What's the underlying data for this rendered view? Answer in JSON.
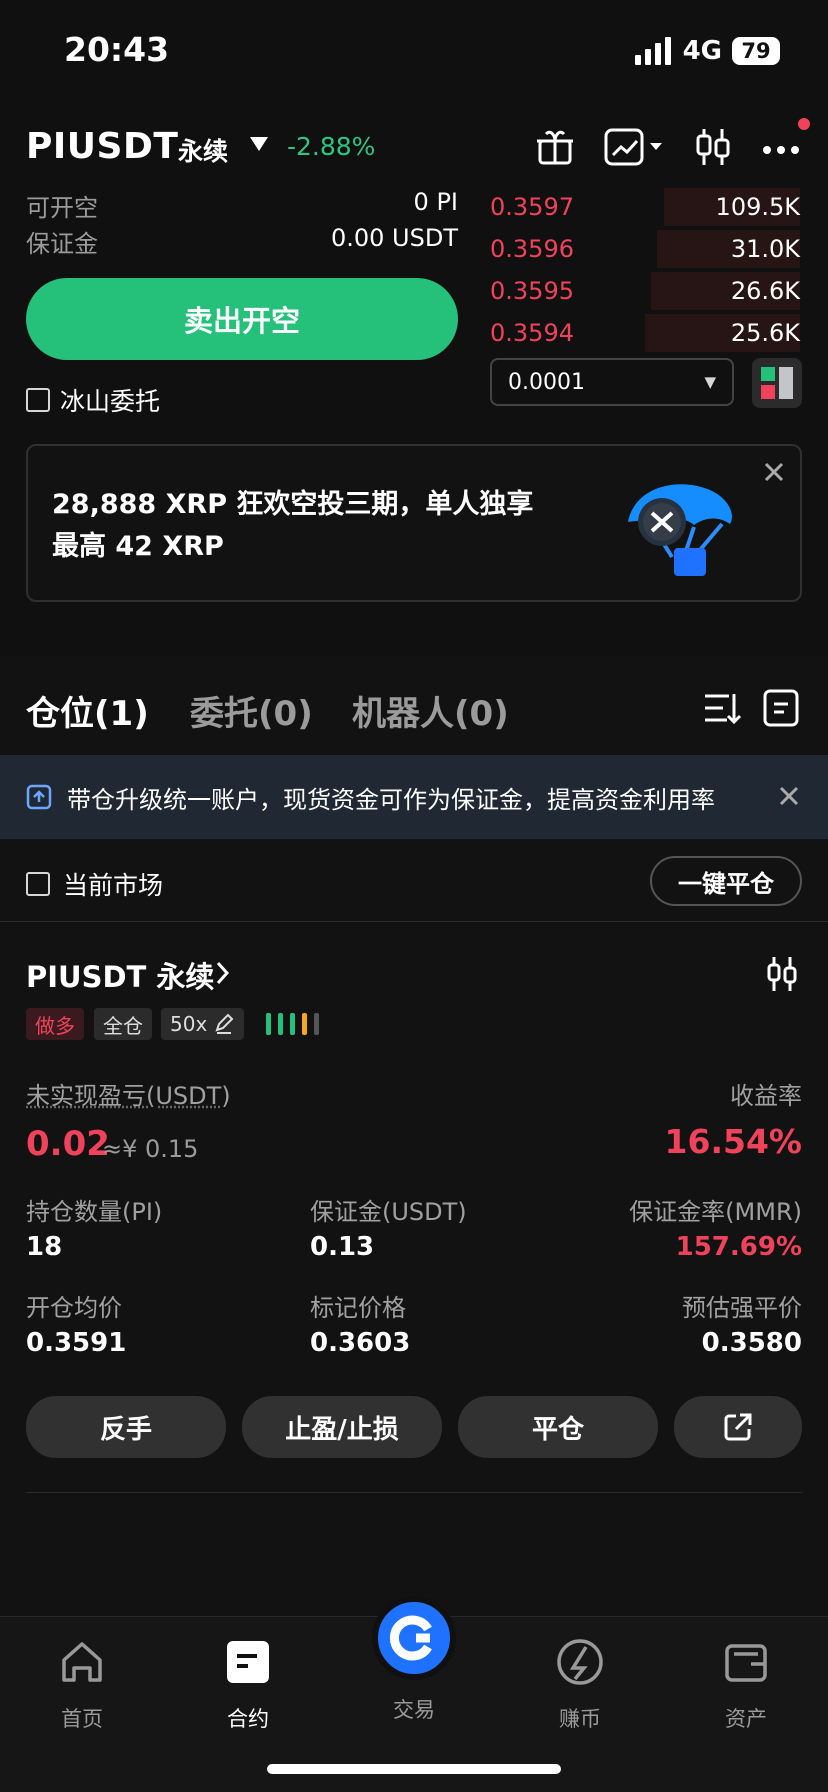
{
  "status": {
    "time": "20:43",
    "network": "4G",
    "battery": "79"
  },
  "header": {
    "symbol": "PIUSDT",
    "contract_type": "永续",
    "change": "-2.88%"
  },
  "trade": {
    "open_short_label": "可开空",
    "open_short_value": "0 PI",
    "margin_label": "保证金",
    "margin_value": "0.00 USDT",
    "sell_button": "卖出开空",
    "iceberg_label": "冰山委托",
    "order_book": [
      {
        "price": "0.3597",
        "size": "109.5K",
        "depth": 0.44
      },
      {
        "price": "0.3596",
        "size": "31.0K",
        "depth": 0.46
      },
      {
        "price": "0.3595",
        "size": "26.6K",
        "depth": 0.48
      },
      {
        "price": "0.3594",
        "size": "25.6K",
        "depth": 0.5
      }
    ],
    "precision": "0.0001"
  },
  "promo": {
    "line1": "28,888 XRP 狂欢空投三期，单人独享",
    "line2": "最高 42 XRP"
  },
  "tabs": [
    "仓位(1)",
    "委托(0)",
    "机器人(0)"
  ],
  "notice": {
    "text": "带仓升级统一账户，现货资金可作为保证金，提高资金利用率"
  },
  "filter": {
    "current_market": "当前市场",
    "close_all": "一键平仓"
  },
  "position": {
    "symbol": "PIUSDT 永续",
    "side": "做多",
    "margin_mode": "全仓",
    "leverage": "50x",
    "unrealized_label": "未实现盈亏(USDT)",
    "unrealized_value": "0.02",
    "unrealized_cny": "≈¥ 0.15",
    "roe_label": "收益率",
    "roe_value": "16.54%",
    "qty_label": "持仓数量(PI)",
    "qty_value": "18",
    "margin_label": "保证金(USDT)",
    "margin_value": "0.13",
    "mmr_label": "保证金率(MMR)",
    "mmr_value": "157.69%",
    "entry_label": "开仓均价",
    "entry_value": "0.3591",
    "mark_label": "标记价格",
    "mark_value": "0.3603",
    "liq_label": "预估强平价",
    "liq_value": "0.3580",
    "buttons": [
      "反手",
      "止盈/止损",
      "平仓"
    ]
  },
  "nav": [
    "首页",
    "合约",
    "交易",
    "赚币",
    "资产"
  ],
  "colors": {
    "green": "#25c17b",
    "red": "#f0435b",
    "blue": "#1f72ff"
  }
}
